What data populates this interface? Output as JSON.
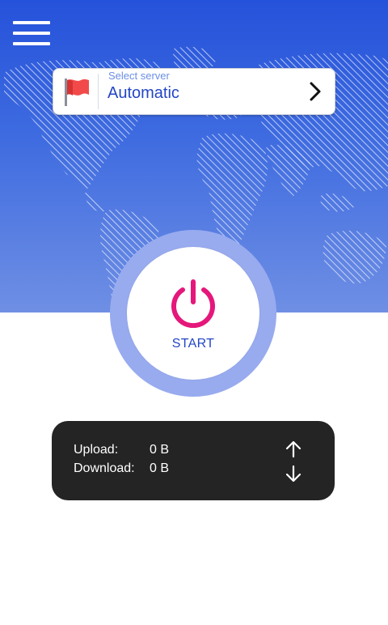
{
  "header": {
    "menu_icon": "hamburger-menu-icon"
  },
  "server": {
    "hint": "Select server",
    "value": "Automatic",
    "flag_icon": "red-flag-icon",
    "chevron_icon": "chevron-right-icon"
  },
  "power": {
    "label": "START",
    "icon": "power-icon",
    "accent": "#e5177b"
  },
  "stats": {
    "upload_label": "Upload:",
    "upload_value": "0 B",
    "download_label": "Download:",
    "download_value": "0 B"
  },
  "colors": {
    "hero_top": "#2552da",
    "hero_bottom": "#6f8fe4",
    "ring": "#98abef",
    "text_accent": "#2346c6",
    "stats_bg": "#242424"
  }
}
